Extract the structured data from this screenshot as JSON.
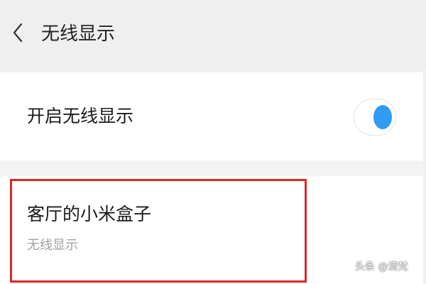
{
  "header": {
    "back_icon": "chevron-left-icon",
    "title": "无线显示"
  },
  "wireless_toggle": {
    "label": "开启无线显示",
    "state": "on",
    "accent_color": "#2f9bf3"
  },
  "device": {
    "name": "客厅的小米盒子",
    "subtitle": "无线显示",
    "highlight_color": "#e02525"
  },
  "watermark": {
    "text": "头条 @清梵"
  }
}
